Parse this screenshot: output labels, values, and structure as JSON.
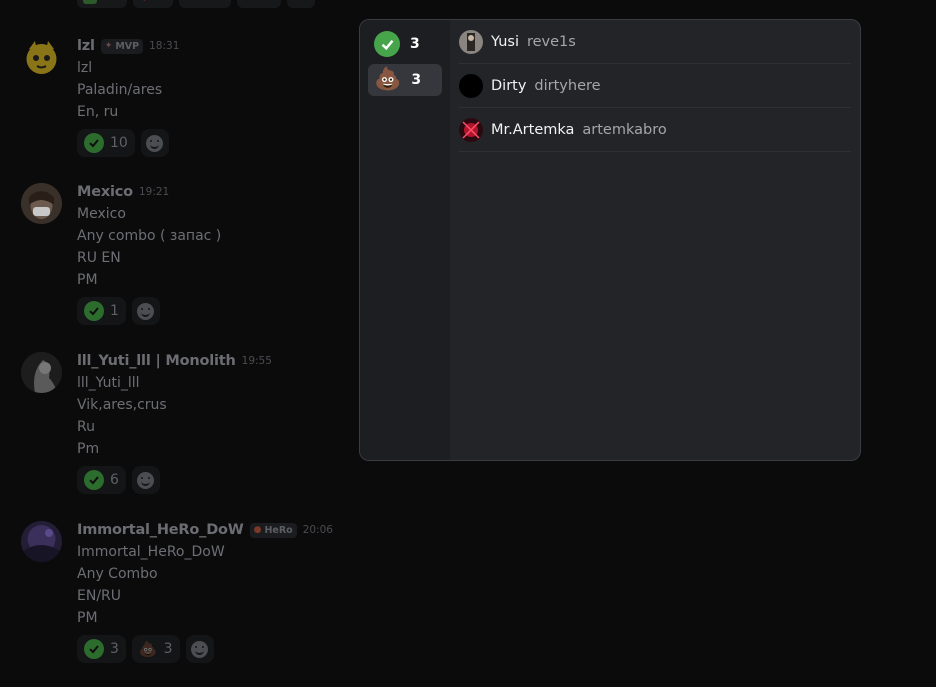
{
  "messages": [
    {
      "username": "lzl",
      "badge": "MVP",
      "time": "18:31",
      "lines": [
        "lzl",
        "Paladin/ares",
        "En, ru"
      ],
      "reactions": [
        {
          "emoji": "check-icon",
          "count": "10"
        }
      ]
    },
    {
      "username": "Mexico",
      "time": "19:21",
      "lines": [
        "Mexico",
        "Any combo ( запас )",
        "RU EN",
        "PM"
      ],
      "reactions": [
        {
          "emoji": "check-icon",
          "count": "1"
        }
      ]
    },
    {
      "username": "lll_Yuti_lll | Monolith",
      "time": "19:55",
      "lines": [
        "lll_Yuti_lll",
        "Vik,ares,crus",
        "Ru",
        "Pm"
      ],
      "reactions": [
        {
          "emoji": "check-icon",
          "count": "6"
        }
      ]
    },
    {
      "username": "Immortal_HeRo_DoW",
      "badge": "HeRo",
      "time": "20:06",
      "lines": [
        "Immortal_HeRo_DoW",
        "Any Combo",
        "EN/RU",
        "PM"
      ],
      "reactions": [
        {
          "emoji": "check-icon",
          "count": "3"
        },
        {
          "emoji": "poop-icon",
          "count": "3"
        }
      ]
    }
  ],
  "popup": {
    "tabs": [
      {
        "emoji": "check-icon",
        "count": "3"
      },
      {
        "emoji": "poop-icon",
        "count": "3",
        "active": true
      }
    ],
    "users": [
      {
        "name": "Yusi",
        "handle": "reve1s"
      },
      {
        "name": "Dirty",
        "handle": "dirtyhere"
      },
      {
        "name": "Mr.Artemka",
        "handle": "artemkabro"
      }
    ]
  },
  "colors": {
    "background": "#0b0b0c",
    "popup": "#232428",
    "check": "#46a54a"
  }
}
